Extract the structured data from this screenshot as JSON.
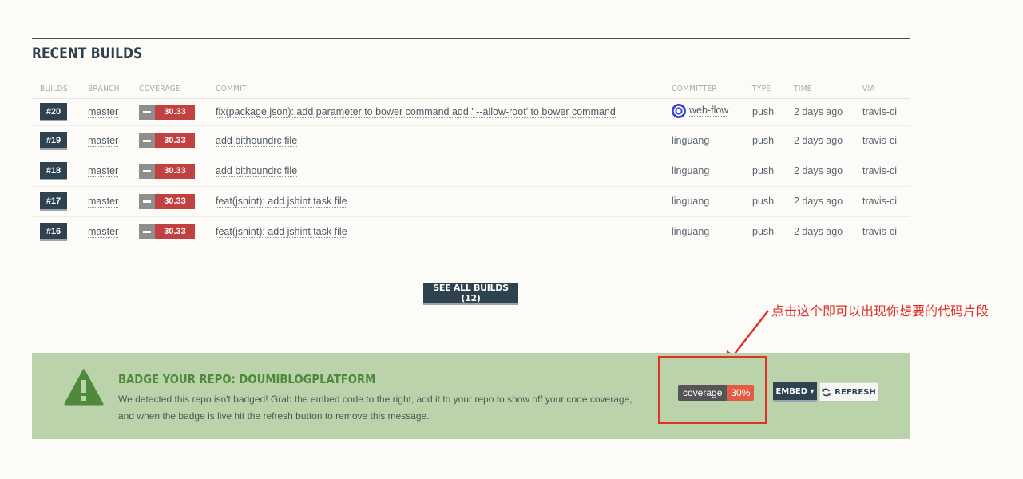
{
  "section": {
    "title": "RECENT BUILDS"
  },
  "columns": [
    "BUILDS",
    "BRANCH",
    "COVERAGE",
    "COMMIT",
    "COMMITTER",
    "TYPE",
    "TIME",
    "VIA"
  ],
  "builds": [
    {
      "num": "#20",
      "branch": "master",
      "coverage": "30.33",
      "commit": "fix(package.json): add parameter to bower command add ' --allow-root' to bower command",
      "committer": "web-flow",
      "committer_has_avatar": true,
      "type": "push",
      "time": "2 days ago",
      "via": "travis-ci"
    },
    {
      "num": "#19",
      "branch": "master",
      "coverage": "30.33",
      "commit": "add bithoundrc file",
      "committer": "linguang",
      "type": "push",
      "time": "2 days ago",
      "via": "travis-ci"
    },
    {
      "num": "#18",
      "branch": "master",
      "coverage": "30.33",
      "commit": "add bithoundrc file",
      "committer": "linguang",
      "type": "push",
      "time": "2 days ago",
      "via": "travis-ci"
    },
    {
      "num": "#17",
      "branch": "master",
      "coverage": "30.33",
      "commit": "feat(jshint): add jshint task file",
      "committer": "linguang",
      "type": "push",
      "time": "2 days ago",
      "via": "travis-ci"
    },
    {
      "num": "#16",
      "branch": "master",
      "coverage": "30.33",
      "commit": "feat(jshint): add jshint task file",
      "committer": "linguang",
      "type": "push",
      "time": "2 days ago",
      "via": "travis-ci"
    }
  ],
  "see_all_label": "SEE ALL BUILDS (12)",
  "annotation": "点击这个即可以出现你想要的代码片段",
  "badge": {
    "title": "BADGE YOUR REPO: DOUMIBLOGPLATFORM",
    "desc_line1": "We detected this repo isn't badged! Grab the embed code to the right, add it to your repo to show off your code coverage,",
    "desc_line2": "and when the badge is live hit the refresh button to remove this message.",
    "coverage_label": "coverage",
    "coverage_value": "30%",
    "embed_label": "EMBED ▾",
    "refresh_label": "REFRESH"
  },
  "colors": {
    "accent": "#2f4250",
    "coverage_red": "#c0413f",
    "badge_bg": "#bad3aa",
    "annotation_red": "#e0302a"
  }
}
